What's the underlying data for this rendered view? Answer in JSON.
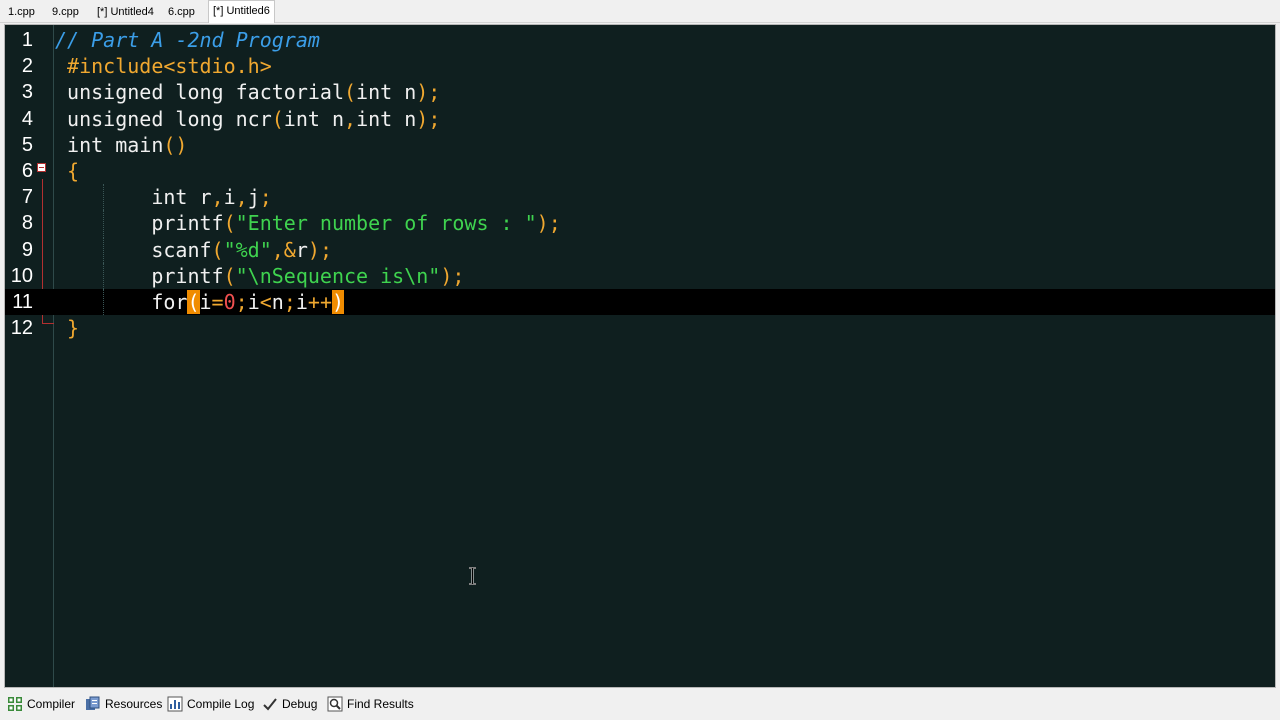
{
  "tabs": [
    {
      "label": "1.cpp",
      "active": false
    },
    {
      "label": "9.cpp",
      "active": false
    },
    {
      "label": "[*] Untitled4",
      "active": false
    },
    {
      "label": "6.cpp",
      "active": false
    },
    {
      "label": "[*] Untitled6",
      "active": true
    }
  ],
  "editor": {
    "current_line": 11,
    "lines": [
      {
        "num": "1",
        "tokens": [
          {
            "t": "comment",
            "v": "// Part A -2nd Program"
          }
        ]
      },
      {
        "num": "2",
        "tokens": [
          {
            "t": "pre",
            "v": " #include<stdio.h>"
          }
        ]
      },
      {
        "num": "3",
        "tokens": [
          {
            "t": "kw",
            "v": " unsigned long factorial"
          },
          {
            "t": "sym",
            "v": "("
          },
          {
            "t": "kw",
            "v": "int n"
          },
          {
            "t": "sym",
            "v": ");"
          }
        ]
      },
      {
        "num": "4",
        "tokens": [
          {
            "t": "kw",
            "v": " unsigned long ncr"
          },
          {
            "t": "sym",
            "v": "("
          },
          {
            "t": "kw",
            "v": "int n"
          },
          {
            "t": "sym",
            "v": ","
          },
          {
            "t": "kw",
            "v": "int n"
          },
          {
            "t": "sym",
            "v": ");"
          }
        ]
      },
      {
        "num": "5",
        "tokens": [
          {
            "t": "kw",
            "v": " int main"
          },
          {
            "t": "sym",
            "v": "()"
          }
        ]
      },
      {
        "num": "6",
        "tokens": [
          {
            "t": "brace",
            "v": " {"
          }
        ]
      },
      {
        "num": "7",
        "tokens": [
          {
            "t": "id",
            "v": "        int r"
          },
          {
            "t": "sym",
            "v": ","
          },
          {
            "t": "id",
            "v": "i"
          },
          {
            "t": "sym",
            "v": ","
          },
          {
            "t": "id",
            "v": "j"
          },
          {
            "t": "sym",
            "v": ";"
          }
        ]
      },
      {
        "num": "8",
        "tokens": [
          {
            "t": "id",
            "v": "        printf"
          },
          {
            "t": "sym",
            "v": "("
          },
          {
            "t": "str",
            "v": "\"Enter number of rows : \""
          },
          {
            "t": "sym",
            "v": ");"
          }
        ]
      },
      {
        "num": "9",
        "tokens": [
          {
            "t": "id",
            "v": "        scanf"
          },
          {
            "t": "sym",
            "v": "("
          },
          {
            "t": "str",
            "v": "\"%d\""
          },
          {
            "t": "sym",
            "v": ",&"
          },
          {
            "t": "id",
            "v": "r"
          },
          {
            "t": "sym",
            "v": ");"
          }
        ]
      },
      {
        "num": "10",
        "tokens": [
          {
            "t": "id",
            "v": "        printf"
          },
          {
            "t": "sym",
            "v": "("
          },
          {
            "t": "str",
            "v": "\"\\nSequence is\\n\""
          },
          {
            "t": "sym",
            "v": ");"
          }
        ]
      },
      {
        "num": "11",
        "tokens": [
          {
            "t": "id",
            "v": "        for"
          },
          {
            "t": "match",
            "v": "("
          },
          {
            "t": "id",
            "v": "i"
          },
          {
            "t": "sym",
            "v": "="
          },
          {
            "t": "num",
            "v": "0"
          },
          {
            "t": "sym",
            "v": ";"
          },
          {
            "t": "id",
            "v": "i"
          },
          {
            "t": "sym",
            "v": "<"
          },
          {
            "t": "id",
            "v": "n"
          },
          {
            "t": "sym",
            "v": ";"
          },
          {
            "t": "id",
            "v": "i"
          },
          {
            "t": "sym",
            "v": "++"
          },
          {
            "t": "match",
            "v": ")"
          }
        ]
      },
      {
        "num": "12",
        "tokens": [
          {
            "t": "brace",
            "v": " }"
          }
        ]
      }
    ]
  },
  "bottom_tabs": [
    {
      "label": "Compiler",
      "icon": "compiler-grid-icon"
    },
    {
      "label": "Resources",
      "icon": "resources-icon"
    },
    {
      "label": "Compile Log",
      "icon": "compile-log-chart-icon"
    },
    {
      "label": "Debug",
      "icon": "debug-check-icon"
    },
    {
      "label": "Find Results",
      "icon": "find-results-icon"
    }
  ],
  "colors": {
    "editor_bg": "#0f1f1f",
    "comment": "#3b9ee8",
    "preprocessor": "#f0a830",
    "string": "#3fd34f",
    "number": "#f05050",
    "bracket_match": "#f08c00"
  }
}
